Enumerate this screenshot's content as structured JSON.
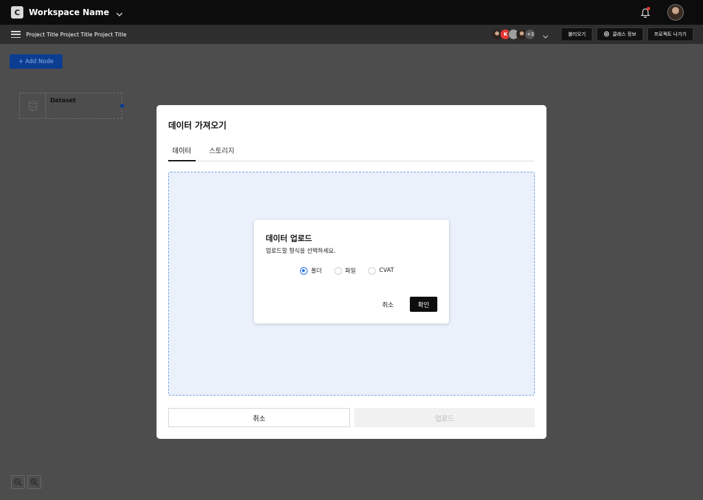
{
  "workspace": {
    "initial": "C",
    "name": "Workspace Name"
  },
  "project": {
    "title": "Project Title Project Title Project Title"
  },
  "collaborators": {
    "initial": "K",
    "more": "+3"
  },
  "toolbar": {
    "load": "불러오기",
    "class_info": "클래스 정보",
    "exit": "프로젝트 나가기"
  },
  "canvas": {
    "add_node": "+ Add Node",
    "node": {
      "title": "Dataset",
      "subtitle": "-"
    }
  },
  "modal": {
    "title": "데이터 가져오기",
    "tabs": [
      {
        "label": "데이터",
        "active": true
      },
      {
        "label": "스토리지",
        "active": false
      }
    ],
    "cancel": "취소",
    "upload": "업로드"
  },
  "dialog": {
    "title": "데이터 업로드",
    "description": "업로드할 형식을 선택하세요.",
    "options": [
      {
        "label": "폴더",
        "selected": true
      },
      {
        "label": "파일",
        "selected": false
      },
      {
        "label": "CVAT",
        "selected": false
      }
    ],
    "cancel": "취소",
    "confirm": "확인"
  },
  "colors": {
    "accent": "#1a6ce8",
    "add_node_bg": "#0b3d91",
    "dropzone_bg": "#eaf1fb",
    "notification_dot": "#e53935"
  },
  "icons": [
    "chevron-down-icon",
    "bell-icon",
    "menu-icon",
    "gear-icon",
    "database-icon",
    "zoom-out-icon",
    "zoom-in-icon"
  ]
}
